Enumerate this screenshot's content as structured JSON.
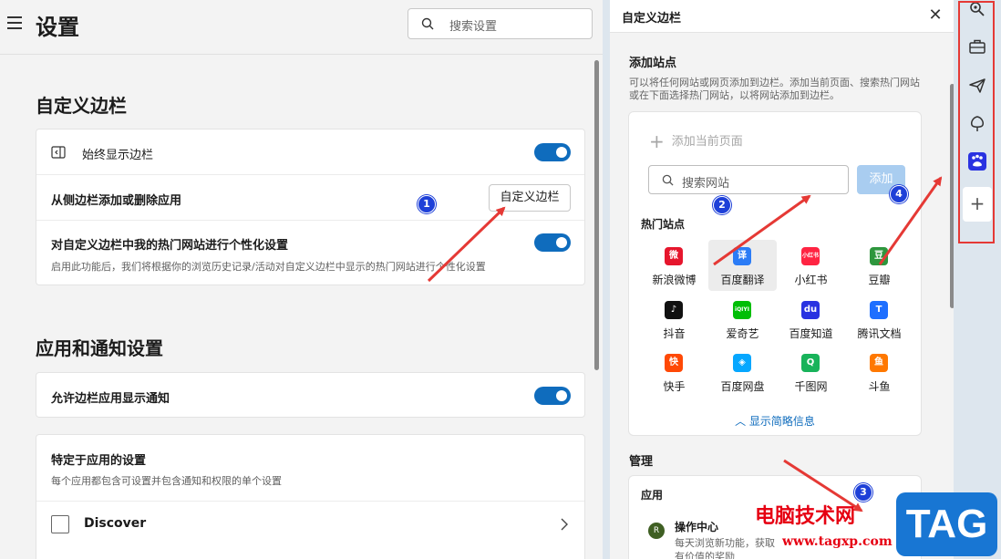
{
  "settings": {
    "title": "设置",
    "search_placeholder": "搜索设置",
    "section1": {
      "title": "自定义边栏",
      "always_show": "始终显示边栏",
      "add_remove": "从侧边栏添加或删除应用",
      "customize_button": "自定义边栏",
      "personalize": "对自定义边栏中我的热门网站进行个性化设置",
      "personalize_desc": "启用此功能后，我们将根据你的浏览历史记录/活动对自定义边栏中显示的热门网站进行个性化设置"
    },
    "section2": {
      "title": "应用和通知设置",
      "allow_notify": "允许边栏应用显示通知",
      "app_specific": "特定于应用的设置",
      "app_specific_desc": "每个应用都包含可设置并包含通知和权限的单个设置",
      "discover": "Discover"
    }
  },
  "sidebar_panel": {
    "title": "自定义边栏",
    "close_icon": "✕",
    "add_site_title": "添加站点",
    "add_site_desc": "可以将任何网站或网页添加到边栏。添加当前页面、搜索热门网站或在下面选择热门网站，以将网站添加到边栏。",
    "add_current": "添加当前页面",
    "search_placeholder": "搜索网站",
    "add_button": "添加",
    "hot_sites_title": "热门站点",
    "sites": [
      {
        "name": "新浪微博",
        "glyph": "微",
        "color": "#e6162d"
      },
      {
        "name": "百度翻译",
        "glyph": "译",
        "color": "#2b7cf6",
        "selected": true
      },
      {
        "name": "小红书",
        "glyph": "小红书",
        "color": "#ff2442"
      },
      {
        "name": "豆瓣",
        "glyph": "豆",
        "color": "#2e963d"
      },
      {
        "name": "抖音",
        "glyph": "♪",
        "color": "#111111"
      },
      {
        "name": "爱奇艺",
        "glyph": "iQIYI",
        "color": "#00be06"
      },
      {
        "name": "百度知道",
        "glyph": "du",
        "color": "#2932e1"
      },
      {
        "name": "腾讯文档",
        "glyph": "T",
        "color": "#1e6fff"
      },
      {
        "name": "快手",
        "glyph": "快",
        "color": "#ff4906"
      },
      {
        "name": "百度网盘",
        "glyph": "◈",
        "color": "#06a7ff"
      },
      {
        "name": "千图网",
        "glyph": "Q",
        "color": "#18b35a"
      },
      {
        "name": "斗鱼",
        "glyph": "鱼",
        "color": "#ff7800"
      }
    ],
    "show_less": "显示简略信息",
    "manage_title": "管理",
    "apps_group": "应用",
    "app_avatar": "R",
    "app_name": "操作中心",
    "app_desc": "每天浏览新功能，获取有价值的奖励"
  },
  "strip": {
    "icons": [
      "search-icon",
      "toolbox-icon",
      "send-icon",
      "tree-icon",
      "baidu-icon"
    ],
    "add": "+"
  },
  "annotations": {
    "badges": [
      "1",
      "2",
      "3",
      "4"
    ]
  },
  "watermark": {
    "text": "电脑技术网",
    "url": "www.tagxp.com",
    "tag": "TAG"
  }
}
